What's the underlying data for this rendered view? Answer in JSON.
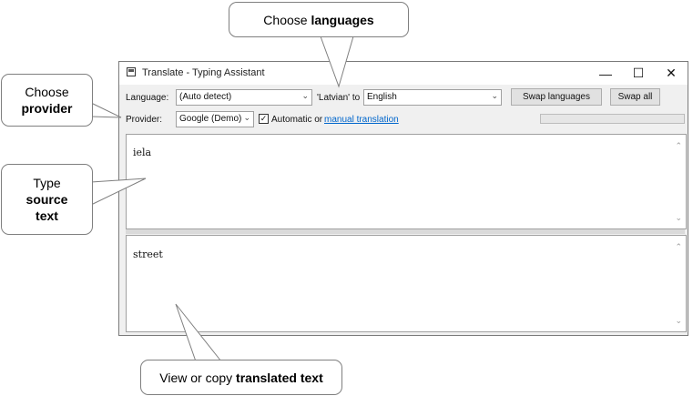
{
  "window": {
    "title": "Translate - Typing Assistant",
    "controls": {
      "minimize": "—",
      "maximize": "☐",
      "close": "✕"
    }
  },
  "toolbar": {
    "language_label": "Language:",
    "source_language": "(Auto detect)",
    "detected_to_label": "'Latvian' to",
    "target_language": "English",
    "swap_languages": "Swap languages",
    "swap_all": "Swap all",
    "provider_label": "Provider:",
    "provider": "Google (Demo)",
    "automatic_label": "Automatic or",
    "automatic_checked": true,
    "manual_translation": "manual translation",
    "progress_fraction": 0
  },
  "source": {
    "text": "iela"
  },
  "result": {
    "text": "street"
  },
  "callouts": {
    "languages": {
      "plain": "Choose",
      "bold": "languages"
    },
    "provider": {
      "plain": "Choose",
      "bold": "provider"
    },
    "source": {
      "plain": "Type",
      "bold1": "source",
      "bold2": "text"
    },
    "translated": {
      "plain": "View or copy",
      "bold": "translated text"
    }
  },
  "colors": {
    "link": "#0066cc",
    "window_bg": "#f0f0f0",
    "callout_border": "#7f7f7f"
  }
}
